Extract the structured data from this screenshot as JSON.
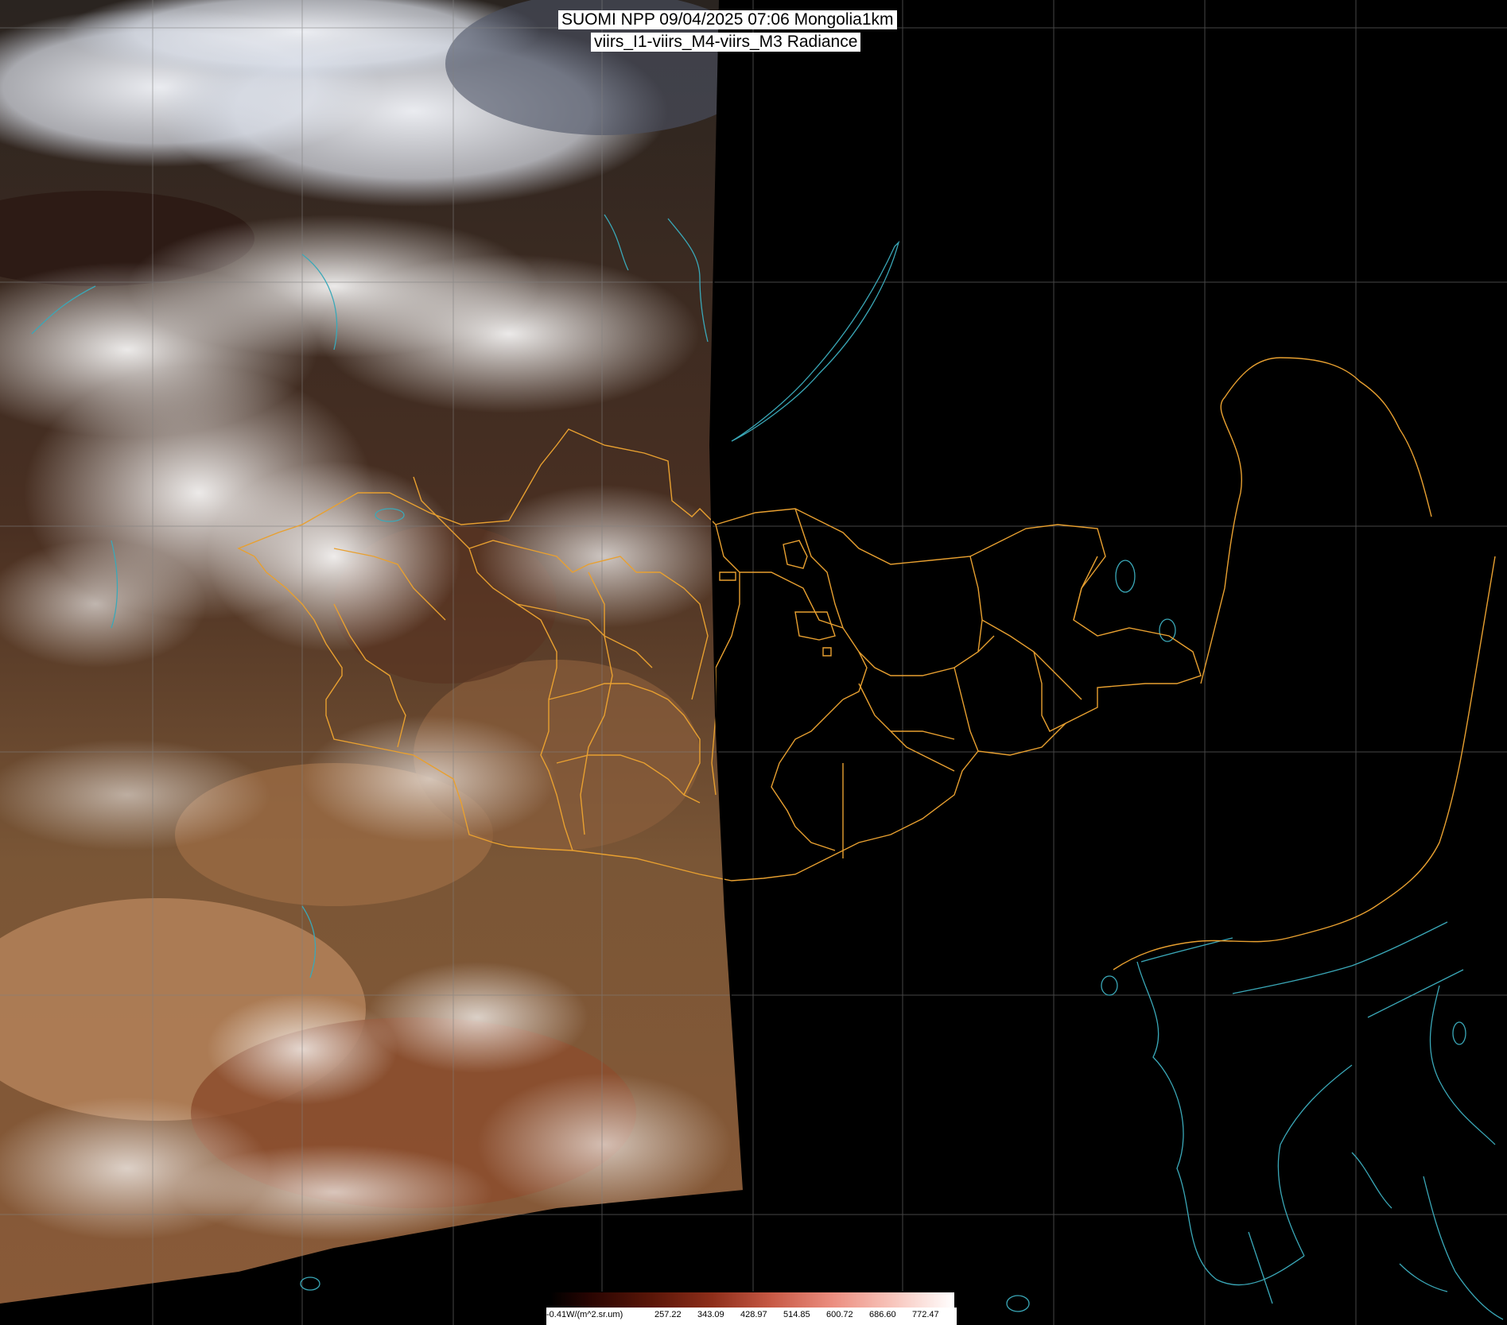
{
  "title": {
    "line1": "SUOMI NPP 09/04/2025 07:06 Mongolia1km",
    "line2": "viirs_I1-viirs_M4-viirs_M3 Radiance"
  },
  "colorbar": {
    "labels": [
      "-0.41W/(m^2.sr.um)",
      "257.22",
      "343.09",
      "428.97",
      "514.85",
      "600.72",
      "686.60",
      "772.47"
    ],
    "colors": [
      "#000000",
      "#3a0a04",
      "#7a2412",
      "#b44a34",
      "#e27a6a",
      "#f4b0a6",
      "#ffffff"
    ]
  },
  "colors": {
    "background": "#000000",
    "grid": "#808080",
    "admin_borders": "#e8a030",
    "coastlines": "#3aa8b8",
    "swath_edge_night": "#000000"
  },
  "map": {
    "region": "Mongolia",
    "grid_lines": true,
    "overlay": [
      "admin-borders",
      "coastlines",
      "lat-lon-grid"
    ]
  }
}
